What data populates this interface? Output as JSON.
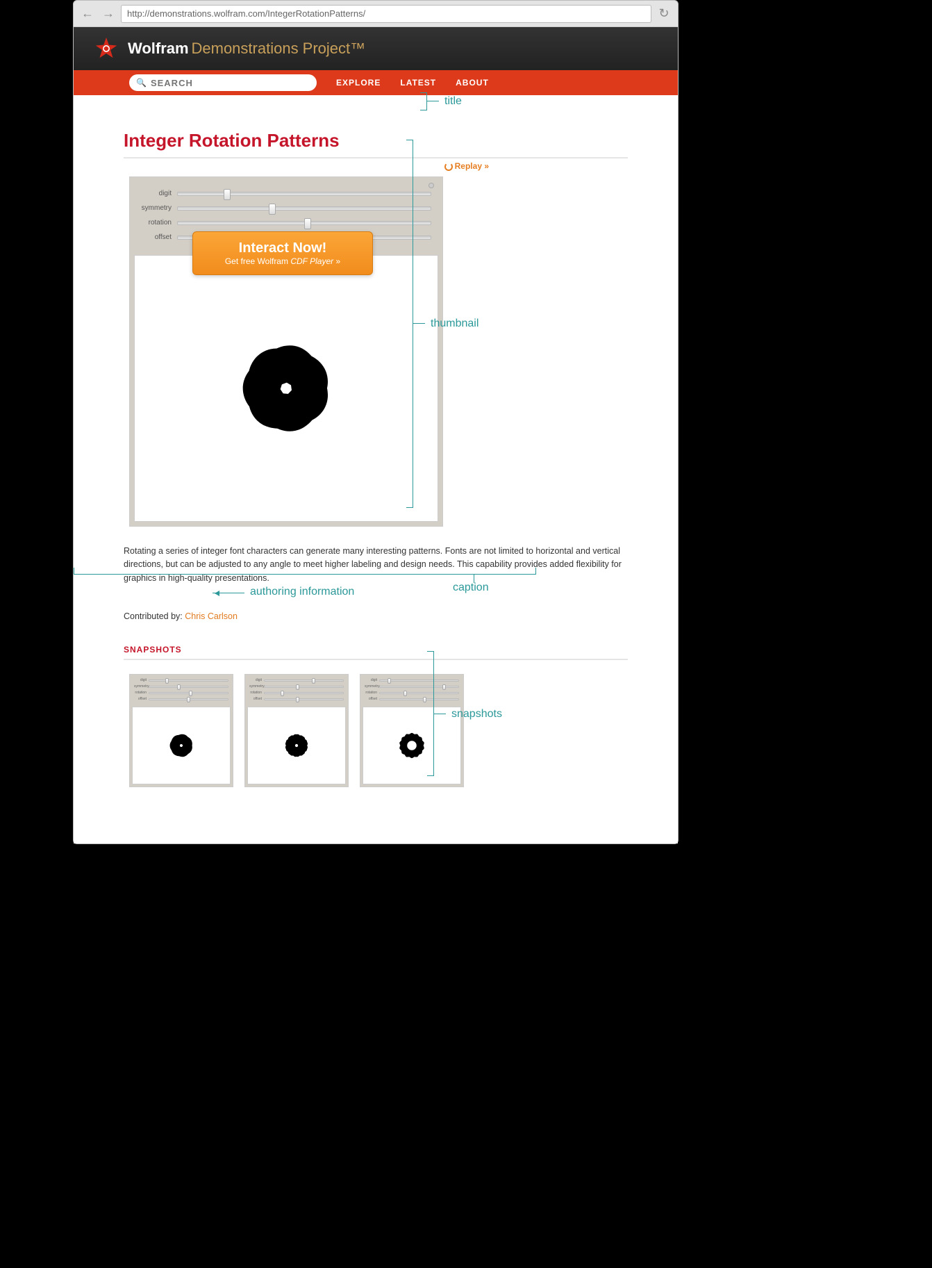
{
  "browser": {
    "url": "http://demonstrations.wolfram.com/IntegerRotationPatterns/"
  },
  "header": {
    "brand1": "Wolfram",
    "brand2": "Demonstrations Project",
    "tm": "™"
  },
  "nav": {
    "search_placeholder": "SEARCH",
    "explore": "EXPLORE",
    "latest": "LATEST",
    "about": "ABOUT"
  },
  "page": {
    "title": "Integer Rotation Patterns",
    "replay": "Replay »",
    "cta_title": "Interact Now!",
    "cta_sub_prefix": "Get free Wolfram ",
    "cta_sub_em": "CDF Player",
    "cta_sub_suffix": " »",
    "caption": "Rotating a series of integer font characters can generate many interesting patterns. Fonts are not limited to horizontal and vertical directions, but can be adjusted to any angle to meet higher labeling and design needs. This capability provides added flexibility for graphics in high-quality presentations.",
    "contrib_label": "Contributed by: ",
    "contrib_author": "Chris Carlson",
    "snapshots_heading": "SNAPSHOTS"
  },
  "controls": [
    {
      "label": "digit",
      "pos": 18
    },
    {
      "label": "symmetry",
      "pos": 36
    },
    {
      "label": "rotation",
      "pos": 50
    },
    {
      "label": "offset",
      "pos": 48
    }
  ],
  "annot": {
    "title": "title",
    "thumbnail": "thumbnail",
    "authoring": "authoring information",
    "caption": "caption",
    "snapshots": "snapshots"
  }
}
